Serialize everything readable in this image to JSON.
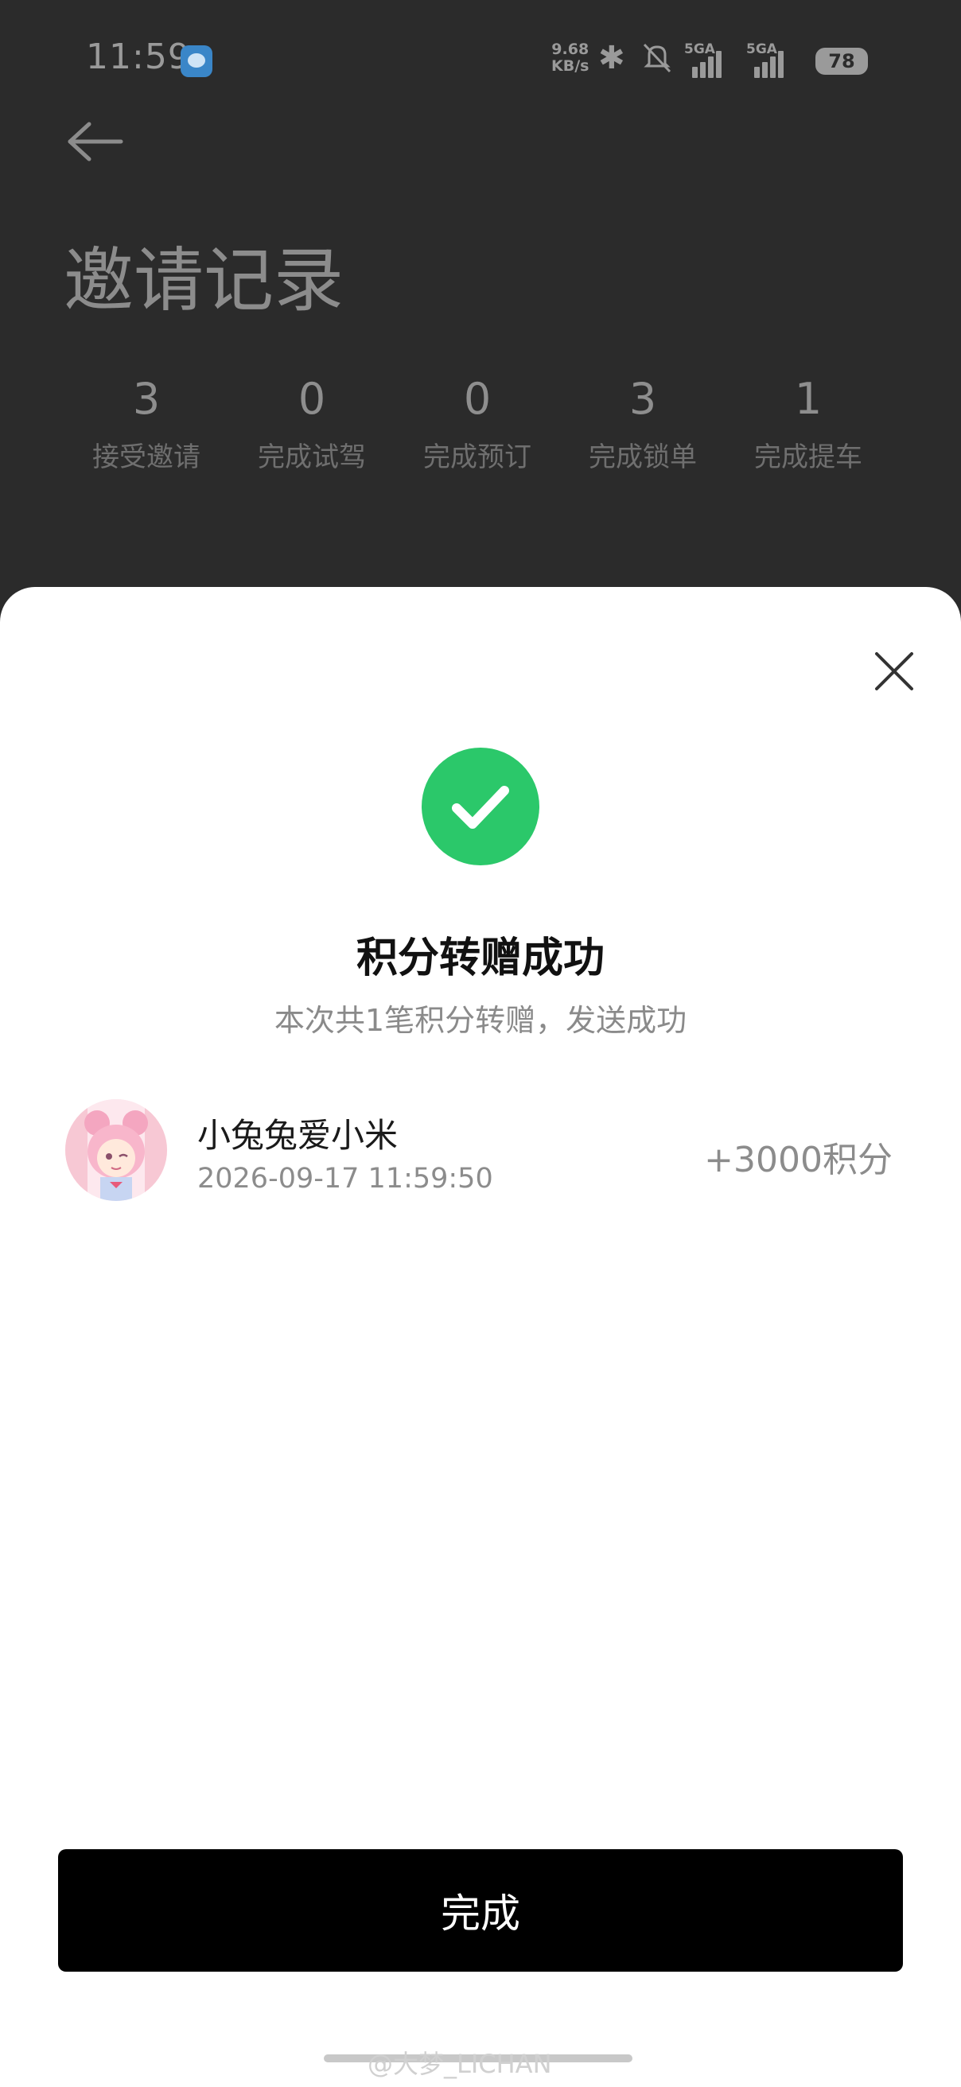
{
  "status_bar": {
    "time": "11:59",
    "net_speed_value": "9.68",
    "net_speed_unit": "KB/s",
    "sim1_label": "5GA",
    "sim2_label": "5GA",
    "battery": "78"
  },
  "page": {
    "title": "邀请记录",
    "stats": [
      {
        "num": "3",
        "label": "接受邀请"
      },
      {
        "num": "0",
        "label": "完成试驾"
      },
      {
        "num": "0",
        "label": "完成预订"
      },
      {
        "num": "3",
        "label": "完成锁单"
      },
      {
        "num": "1",
        "label": "完成提车"
      }
    ]
  },
  "sheet": {
    "title": "积分转赠成功",
    "subtitle": "本次共1笔积分转赠，发送成功",
    "record": {
      "name": "小兔兔爱小米",
      "time": "2026-09-17 11:59:50",
      "points": "+3000积分"
    },
    "done_label": "完成"
  },
  "watermark": "@大梦_LICHAN",
  "colors": {
    "success": "#2bc86a",
    "button": "#000000"
  }
}
